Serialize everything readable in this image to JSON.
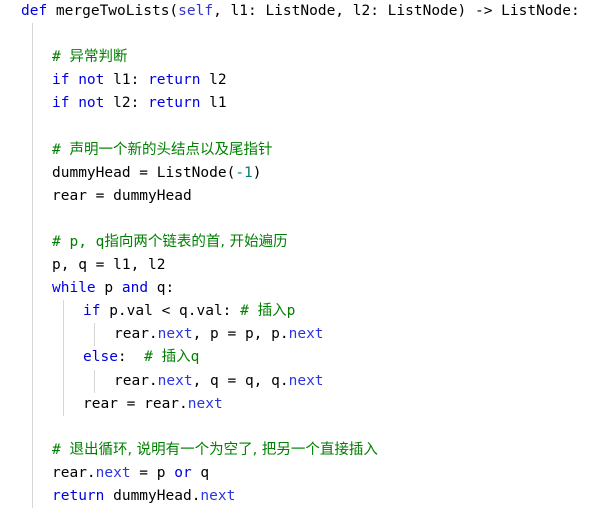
{
  "editor": {
    "language": "python",
    "background_color": "#ffffff",
    "theme": {
      "keyword_color": "#0000e0",
      "comment_color": "#008000",
      "attribute_color": "#2b35e0",
      "number_color": "#0d7a6e",
      "plain_color": "#000000",
      "indent_guide_color": "#d6d6d6"
    }
  },
  "code": {
    "lines": [
      {
        "indent": 0,
        "guides": [],
        "tokens": [
          {
            "t": "def",
            "c": "kw"
          },
          {
            "t": " mergeTwoLists(",
            "c": "pl"
          },
          {
            "t": "self",
            "c": "self"
          },
          {
            "t": ", l1: ListNode, l2: ListNode) -> ListNode:",
            "c": "pl"
          }
        ]
      },
      {
        "indent": 1,
        "guides": [
          1
        ],
        "tokens": []
      },
      {
        "indent": 1,
        "guides": [
          1
        ],
        "tokens": [
          {
            "t": "# ",
            "c": "cm"
          },
          {
            "t": "异常判断",
            "c": "cm cjk"
          }
        ]
      },
      {
        "indent": 1,
        "guides": [
          1
        ],
        "tokens": [
          {
            "t": "if",
            "c": "kw"
          },
          {
            "t": " ",
            "c": "pl"
          },
          {
            "t": "not",
            "c": "kw"
          },
          {
            "t": " l1: ",
            "c": "pl"
          },
          {
            "t": "return",
            "c": "kw"
          },
          {
            "t": " l2",
            "c": "pl"
          }
        ]
      },
      {
        "indent": 1,
        "guides": [
          1
        ],
        "tokens": [
          {
            "t": "if",
            "c": "kw"
          },
          {
            "t": " ",
            "c": "pl"
          },
          {
            "t": "not",
            "c": "kw"
          },
          {
            "t": " l2: ",
            "c": "pl"
          },
          {
            "t": "return",
            "c": "kw"
          },
          {
            "t": " l1",
            "c": "pl"
          }
        ]
      },
      {
        "indent": 1,
        "guides": [
          1
        ],
        "tokens": []
      },
      {
        "indent": 1,
        "guides": [
          1
        ],
        "tokens": [
          {
            "t": "# ",
            "c": "cm"
          },
          {
            "t": "声明一个新的头结点以及尾指针",
            "c": "cm cjk"
          }
        ]
      },
      {
        "indent": 1,
        "guides": [
          1
        ],
        "tokens": [
          {
            "t": "dummyHead = ListNode(",
            "c": "pl"
          },
          {
            "t": "-1",
            "c": "num"
          },
          {
            "t": ")",
            "c": "pl"
          }
        ]
      },
      {
        "indent": 1,
        "guides": [
          1
        ],
        "tokens": [
          {
            "t": "rear = dummyHead",
            "c": "pl"
          }
        ]
      },
      {
        "indent": 1,
        "guides": [
          1
        ],
        "tokens": []
      },
      {
        "indent": 1,
        "guides": [
          1
        ],
        "tokens": [
          {
            "t": "# p, q",
            "c": "cm"
          },
          {
            "t": "指向两个链表的首, 开始遍历",
            "c": "cm cjk"
          }
        ]
      },
      {
        "indent": 1,
        "guides": [
          1
        ],
        "tokens": [
          {
            "t": "p, q = l1, l2",
            "c": "pl"
          }
        ]
      },
      {
        "indent": 1,
        "guides": [
          1
        ],
        "tokens": [
          {
            "t": "while",
            "c": "kw"
          },
          {
            "t": " p ",
            "c": "pl"
          },
          {
            "t": "and",
            "c": "kw"
          },
          {
            "t": " q:",
            "c": "pl"
          }
        ]
      },
      {
        "indent": 2,
        "guides": [
          1,
          2
        ],
        "tokens": [
          {
            "t": "if",
            "c": "kw"
          },
          {
            "t": " p.val < q.val: ",
            "c": "pl"
          },
          {
            "t": "# ",
            "c": "cm"
          },
          {
            "t": "插入",
            "c": "cm cjk"
          },
          {
            "t": "p",
            "c": "cm"
          }
        ]
      },
      {
        "indent": 3,
        "guides": [
          1,
          2,
          3
        ],
        "tokens": [
          {
            "t": "rear.",
            "c": "pl"
          },
          {
            "t": "next",
            "c": "attr"
          },
          {
            "t": ", p = p, p.",
            "c": "pl"
          },
          {
            "t": "next",
            "c": "attr"
          }
        ]
      },
      {
        "indent": 2,
        "guides": [
          1,
          2
        ],
        "tokens": [
          {
            "t": "else",
            "c": "kw"
          },
          {
            "t": ":  ",
            "c": "pl"
          },
          {
            "t": "# ",
            "c": "cm"
          },
          {
            "t": "插入",
            "c": "cm cjk"
          },
          {
            "t": "q",
            "c": "cm"
          }
        ]
      },
      {
        "indent": 3,
        "guides": [
          1,
          2,
          3
        ],
        "tokens": [
          {
            "t": "rear.",
            "c": "pl"
          },
          {
            "t": "next",
            "c": "attr"
          },
          {
            "t": ", q = q, q.",
            "c": "pl"
          },
          {
            "t": "next",
            "c": "attr"
          }
        ]
      },
      {
        "indent": 2,
        "guides": [
          1,
          2
        ],
        "tokens": [
          {
            "t": "rear = rear.",
            "c": "pl"
          },
          {
            "t": "next",
            "c": "attr"
          }
        ]
      },
      {
        "indent": 1,
        "guides": [
          1
        ],
        "tokens": []
      },
      {
        "indent": 1,
        "guides": [
          1
        ],
        "tokens": [
          {
            "t": "# ",
            "c": "cm"
          },
          {
            "t": "退出循环, 说明有一个为空了, 把另一个直接插入",
            "c": "cm cjk"
          }
        ]
      },
      {
        "indent": 1,
        "guides": [
          1
        ],
        "tokens": [
          {
            "t": "rear.",
            "c": "pl"
          },
          {
            "t": "next",
            "c": "attr"
          },
          {
            "t": " = p ",
            "c": "pl"
          },
          {
            "t": "or",
            "c": "kw"
          },
          {
            "t": " q",
            "c": "pl"
          }
        ]
      },
      {
        "indent": 1,
        "guides": [
          1
        ],
        "tokens": [
          {
            "t": "return",
            "c": "kw"
          },
          {
            "t": " dummyHead.",
            "c": "pl"
          },
          {
            "t": "next",
            "c": "attr"
          }
        ]
      }
    ]
  }
}
